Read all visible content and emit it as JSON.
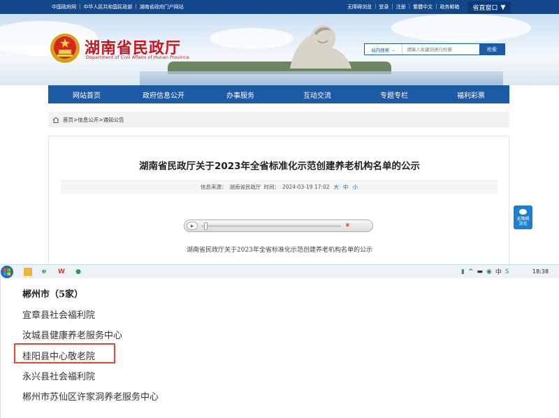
{
  "topbar": {
    "links_left": [
      "中国政府网",
      "中华人民共和国民政部",
      "湖南省政府门户网站"
    ],
    "links_right": [
      "无障碍浏览",
      "登录",
      "注册",
      "繁體中文",
      "政务邮箱"
    ],
    "portal": "省直窗口"
  },
  "header": {
    "title": "湖南省民政厅",
    "subtitle": "Department of Civil Affairs of Hunan Province"
  },
  "search": {
    "scope": "站内搜索",
    "placeholder": "请输入关键词进行检索",
    "button": "检索"
  },
  "nav": {
    "items": [
      "网站首页",
      "政府信息公开",
      "办事服务",
      "互动交流",
      "专题专栏",
      "福利彩票"
    ]
  },
  "breadcrumb": {
    "items": [
      "首页",
      "信息公开",
      "通知公告"
    ],
    "separator": ">"
  },
  "article": {
    "title": "湖南省民政厅关于2023年全省标准化示范创建养老机构名单的公示",
    "source_label": "信息来源：",
    "source": "湖南省民政厅",
    "time_label": "时间：",
    "time": "2024-03-19 17:02",
    "font_sizes": [
      "大",
      "中",
      "小"
    ],
    "subtitle": "湖南省民政厅关于2023年全省标准化示范创建养老机构名单的公示"
  },
  "player": {
    "volume_glyph": "IIIII",
    "progress": 0.02
  },
  "accessibility": {
    "label_line1": "无障碍",
    "label_line2": "浏览"
  },
  "taskbar": {
    "clock": "18:38",
    "tray_icons": [
      "battery-icon",
      "chevron-up-icon",
      "keyboard-icon",
      "network-icon",
      "ime-icon",
      "antivirus-icon"
    ],
    "tray_ime": "中"
  },
  "list": {
    "heading": "郴州市（5家）",
    "items": [
      "宜章县社会福利院",
      "汝城县健康养老服务中心",
      "桂阳县中心敬老院",
      "永兴县社会福利院",
      "郴州市苏仙区许家洞养老服务中心"
    ],
    "highlight_color": "#e4462f"
  },
  "colors": {
    "brand_blue": "#1d5aa6",
    "brand_red": "#c8161d",
    "topbar": "#12478a"
  }
}
